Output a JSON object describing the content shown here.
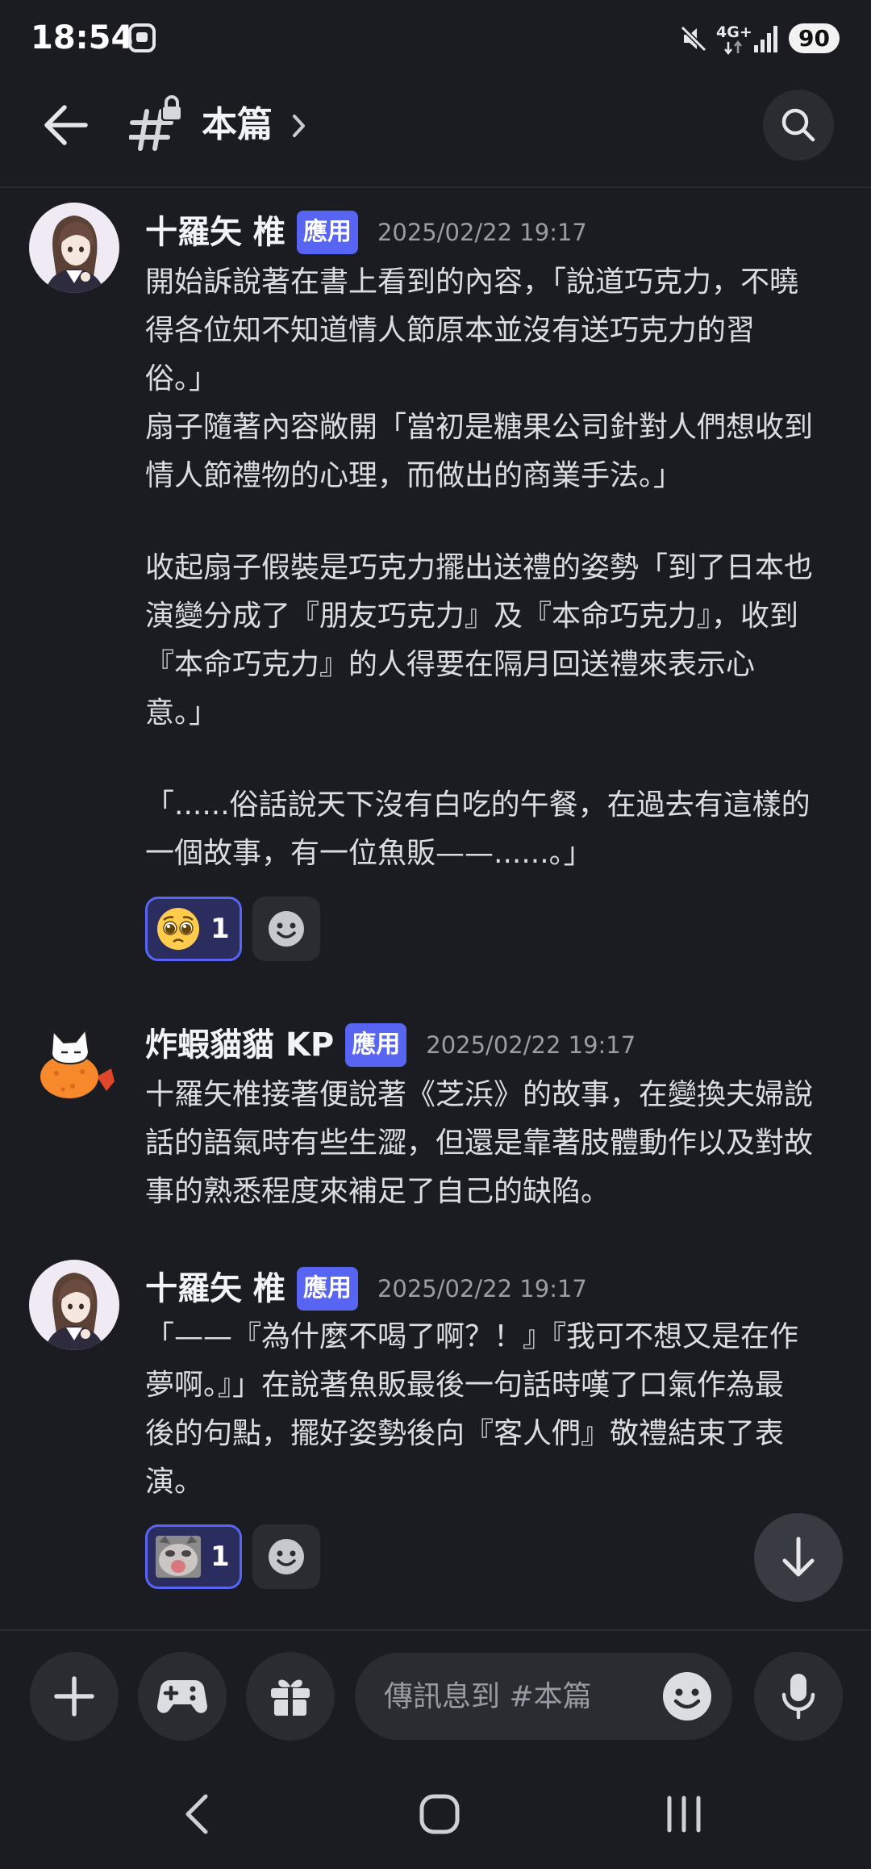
{
  "status_bar": {
    "time": "18:54",
    "network": "4G+",
    "battery": "90"
  },
  "header": {
    "channel_name": "本篇"
  },
  "messages": [
    {
      "author": "十羅矢 椎",
      "badge": "應用",
      "timestamp": "2025/02/22 19:17",
      "paragraphs": [
        [
          "開始訴說著在書上看到的內容，「說道巧克力，不曉",
          "得各位知不知道情人節原本並沒有送巧克力的習",
          "俗。」",
          "扇子隨著內容敞開「當初是糖果公司針對人們想收到",
          "情人節禮物的心理，而做出的商業手法。」"
        ],
        [
          "收起扇子假裝是巧克力擺出送禮的姿勢「到了日本也",
          "演變分成了『朋友巧克力』及『本命巧克力』，收到",
          "『本命巧克力』的人得要在隔月回送禮來表示心",
          "意。」"
        ],
        [
          "「......俗話說天下沒有白吃的午餐，在過去有這樣的",
          "一個故事，有一位魚販——......。」"
        ]
      ],
      "reactions": [
        {
          "emoji": "pleading-face",
          "count": "1"
        }
      ]
    },
    {
      "author": "炸蝦貓貓 KP",
      "badge": "應用",
      "timestamp": "2025/02/22 19:17",
      "paragraphs": [
        [
          "十羅矢椎接著便說著《芝浜》的故事，在變換夫婦說",
          "話的語氣時有些生澀，但還是靠著肢體動作以及對故",
          "事的熟悉程度來補足了自己的缺陷。"
        ]
      ]
    },
    {
      "author": "十羅矢 椎",
      "badge": "應用",
      "timestamp": "2025/02/22 19:17",
      "paragraphs": [
        [
          "「——『為什麼不喝了啊？！』『我可不想又是在作",
          "夢啊。』」在說著魚販最後一句話時嘆了口氣作為最",
          "後的句點，擺好姿勢後向『客人們』敬禮結束了表",
          "演。"
        ]
      ],
      "reactions": [
        {
          "emoji": "cat-image",
          "count": "1"
        }
      ]
    }
  ],
  "composer": {
    "placeholder": "傳訊息到 #本篇"
  },
  "colors": {
    "background": "#1b1c21",
    "surface": "#2b2c32",
    "accent": "#5865F2",
    "text": "#dbdee1",
    "muted_text": "#9b9ca4"
  },
  "icons": {
    "header": [
      "back-arrow-icon",
      "locked-channel-icon",
      "chevron-right-icon",
      "search-icon"
    ],
    "composer": [
      "plus-icon",
      "gamepad-icon",
      "gift-icon",
      "emoji-icon",
      "microphone-icon"
    ],
    "navigation": [
      "nav-back-icon",
      "nav-home-icon",
      "nav-recents-icon"
    ]
  }
}
